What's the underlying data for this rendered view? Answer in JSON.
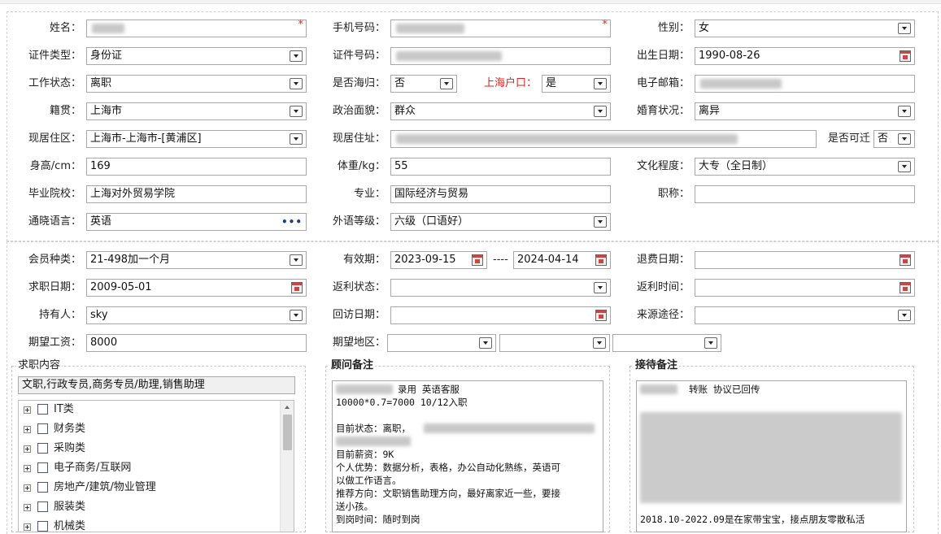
{
  "personal": {
    "name_label": "姓名：",
    "phone_label": "手机号码：",
    "gender_label": "性别：",
    "gender_value": "女",
    "id_type_label": "证件类型：",
    "id_type_value": "身份证",
    "id_number_label": "证件号码：",
    "birth_label": "出生日期：",
    "birth_value": "1990-08-26",
    "work_status_label": "工作状态：",
    "work_status_value": "离职",
    "returnee_label": "是否海归：",
    "returnee_value": "否",
    "shanghai_hukou_label": "上海户口：",
    "shanghai_hukou_value": "是",
    "email_label": "电子邮箱：",
    "origin_label": "籍贯：",
    "origin_value": "上海市",
    "political_label": "政治面貌：",
    "political_value": "群众",
    "marital_label": "婚育状况：",
    "marital_value": "离异",
    "residence_area_label": "现居住区：",
    "residence_area_value": "上海市-上海市-[黄浦区]",
    "residence_address_label": "现居住址：",
    "relocate_label": "是否可迁",
    "relocate_value": "否",
    "height_label": "身高/cm：",
    "height_value": "169",
    "weight_label": "体重/kg：",
    "weight_value": "55",
    "education_label": "文化程度：",
    "education_value": "大专（全日制）",
    "school_label": "毕业院校：",
    "school_value": "上海对外贸易学院",
    "major_label": "专业：",
    "major_value": "国际经济与贸易",
    "title_label": "职称：",
    "title_value": "",
    "languages_label": "通晓语言：",
    "languages_value": "英语",
    "foreign_level_label": "外语等级：",
    "foreign_level_value": "六级（口语好）"
  },
  "membership": {
    "member_type_label": "会员种类：",
    "member_type_value": "21-498加一个月",
    "validity_label": "有效期：",
    "validity_start": "2023-09-15",
    "validity_sep": "----",
    "validity_end": "2024-04-14",
    "refund_date_label": "退费日期：",
    "job_date_label": "求职日期：",
    "job_date_value": "2009-05-01",
    "rebate_status_label": "返利状态：",
    "rebate_time_label": "返利时间：",
    "holder_label": "持有人：",
    "holder_value": "sky",
    "revisit_label": "回访日期：",
    "source_label": "来源途径：",
    "expected_salary_label": "期望工资：",
    "expected_salary_value": "8000",
    "expected_area_label": "期望地区："
  },
  "job_content": {
    "title": "求职内容",
    "summary": "文职,行政专员,商务专员/助理,销售助理",
    "categories": [
      "IT类",
      "财务类",
      "采购类",
      "电子商务/互联网",
      "房地产/建筑/物业管理",
      "服装类",
      "机械类"
    ]
  },
  "consultant_note": {
    "title": "顾问备注",
    "lines": [
      "录用 英语客服",
      "10000*0.7=7000  10/12入职",
      "",
      "目前状态：离职，",
      "",
      "目前薪资：9K",
      "个人优势：数据分析，表格，办公自动化熟练，英语可",
      "以做工作语言。",
      "推荐方向：文职销售助理方向，最好离家近一些，要接",
      "送小孩。",
      "到岗时间：随时到岗"
    ]
  },
  "reception_note": {
    "title": "接待备注",
    "first_line": "转账  协议已回传",
    "last_line": "2018.10-2022.09是在家带宝宝，接点朋友零散私活"
  }
}
